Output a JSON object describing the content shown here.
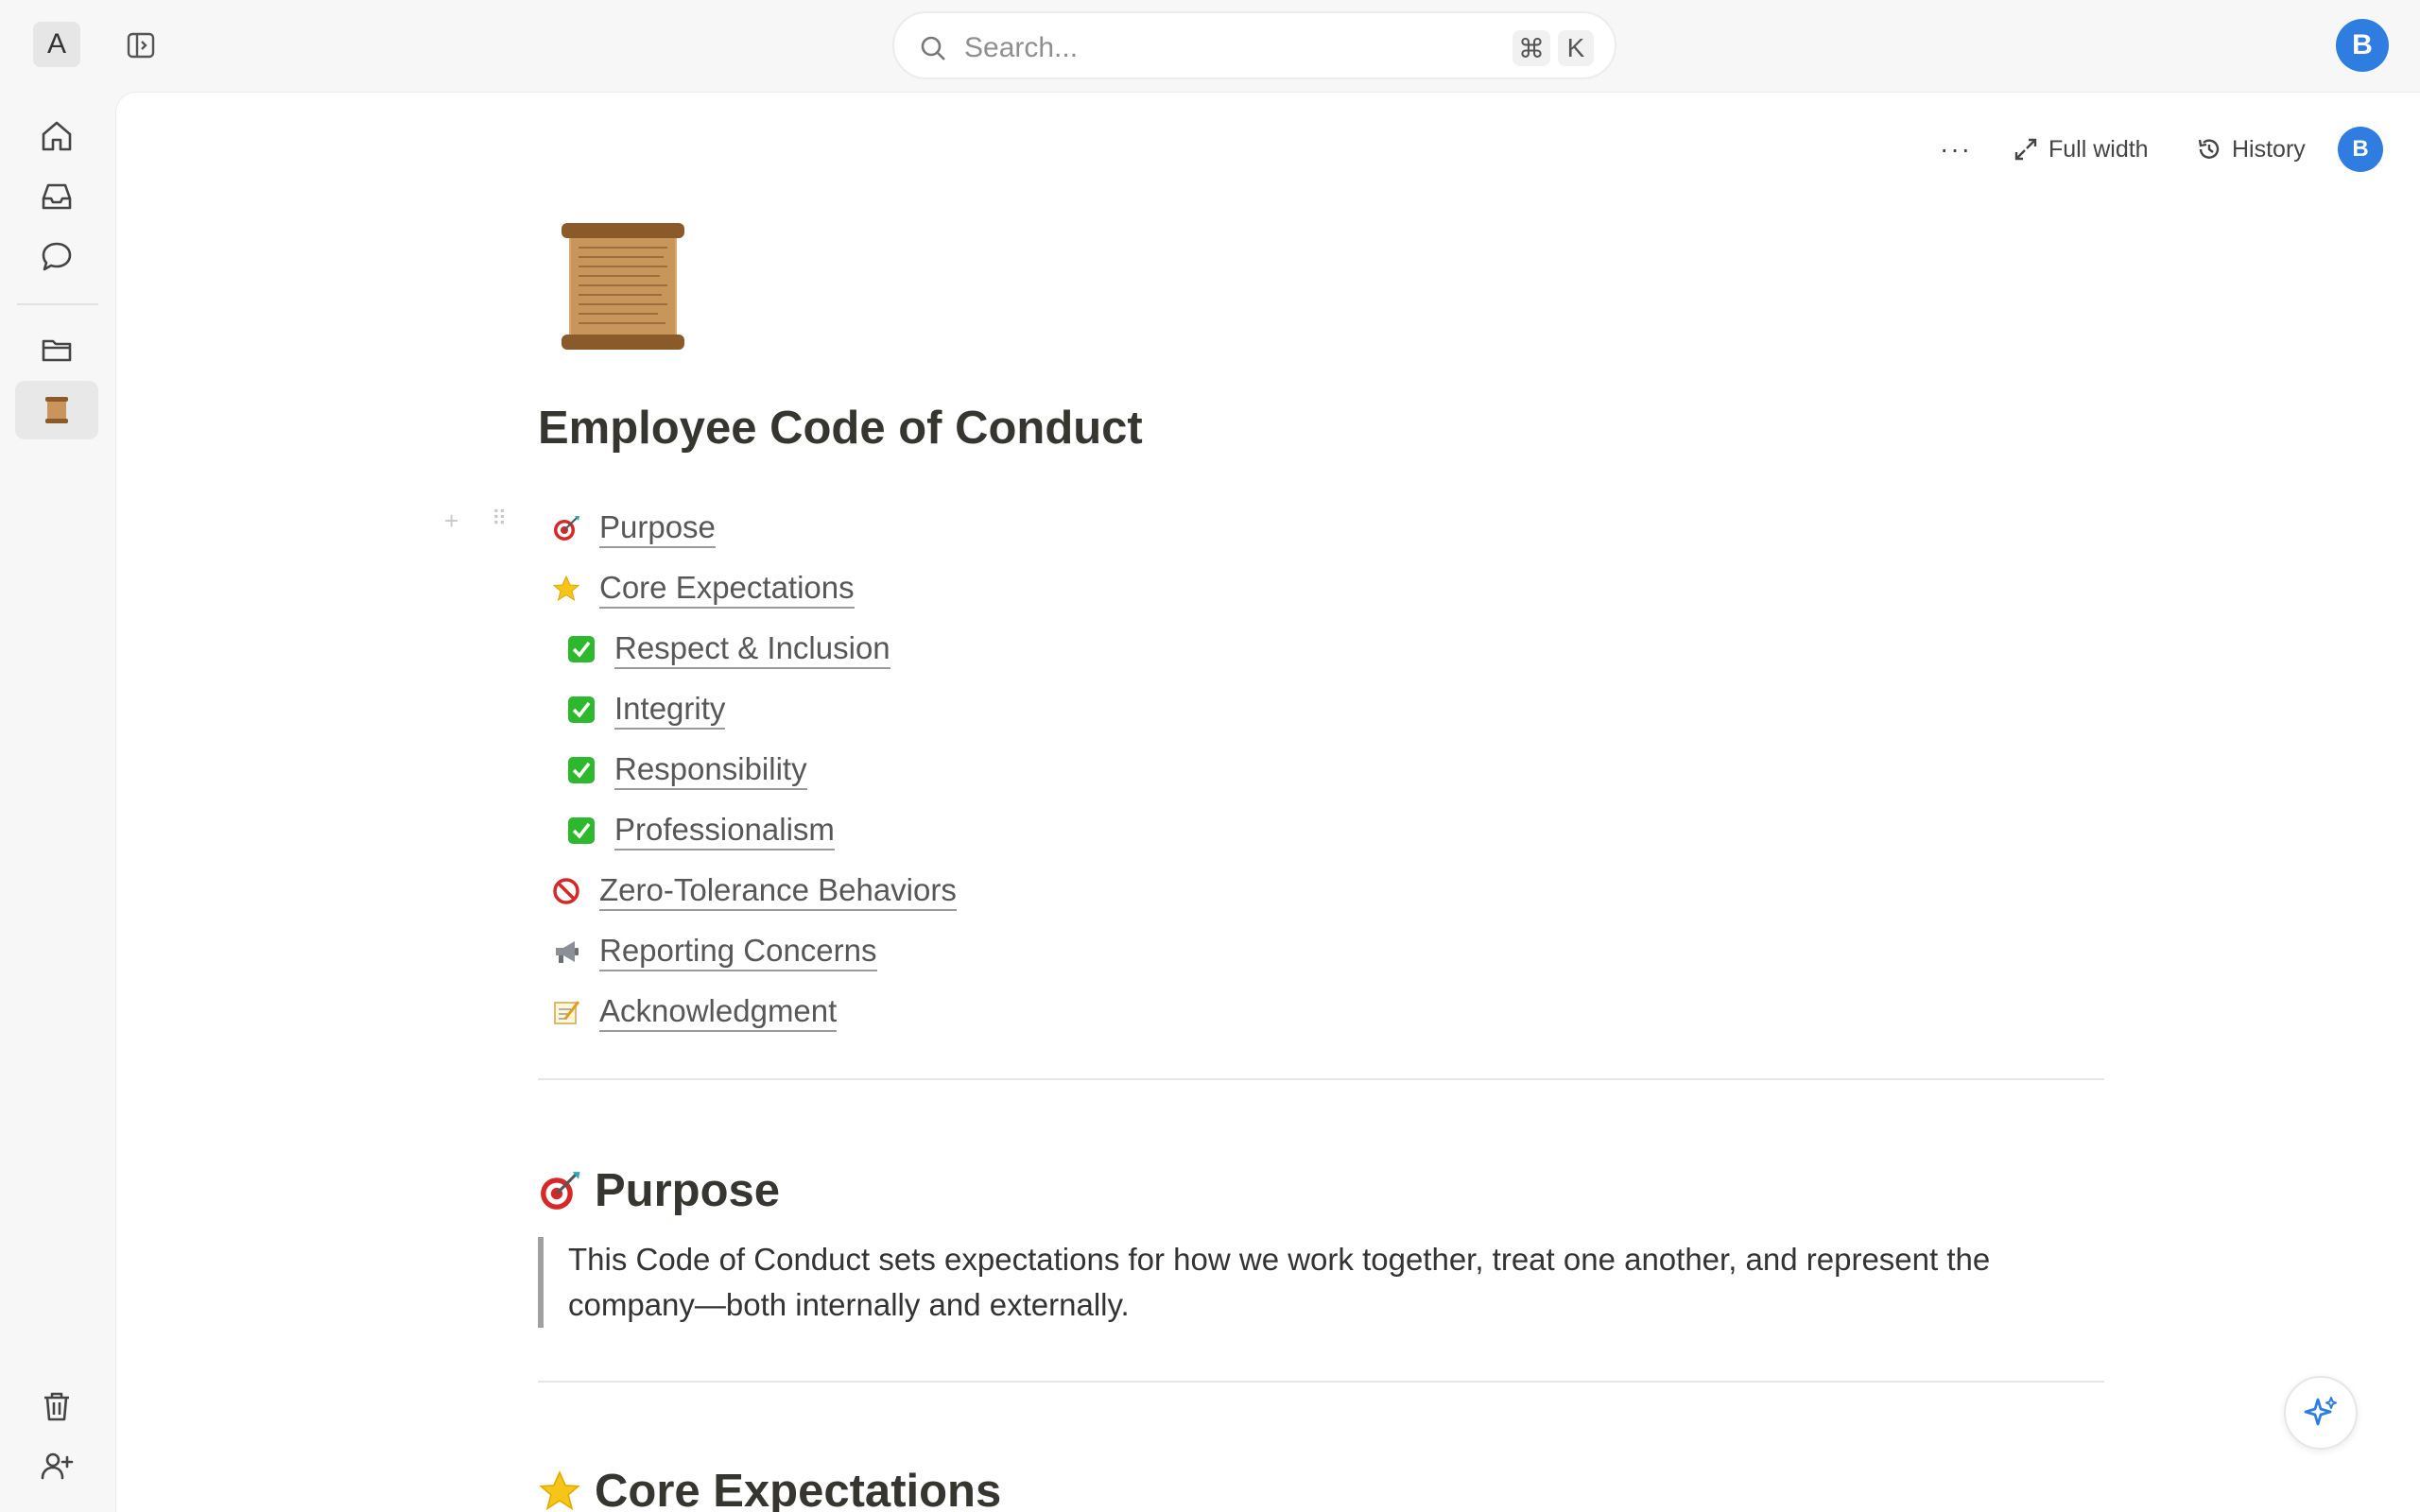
{
  "workspace": {
    "initial": "A"
  },
  "search": {
    "placeholder": "Search...",
    "shortcut_mod": "⌘",
    "shortcut_key": "K"
  },
  "user": {
    "initial": "B"
  },
  "toolbar": {
    "more_label": "···",
    "full_width_label": "Full width",
    "history_label": "History"
  },
  "document": {
    "title": "Employee Code of Conduct",
    "toc": [
      {
        "icon": "target-icon",
        "label": "Purpose"
      },
      {
        "icon": "star-icon",
        "label": "Core Expectations"
      },
      {
        "icon": "check-icon",
        "label": "Respect & Inclusion"
      },
      {
        "icon": "check-icon",
        "label": "Integrity"
      },
      {
        "icon": "check-icon",
        "label": "Responsibility"
      },
      {
        "icon": "check-icon",
        "label": "Professionalism"
      },
      {
        "icon": "prohibited-icon",
        "label": "Zero-Tolerance Behaviors"
      },
      {
        "icon": "megaphone-icon",
        "label": "Reporting Concerns"
      },
      {
        "icon": "memo-icon",
        "label": "Acknowledgment"
      }
    ],
    "sections": [
      {
        "icon": "target-icon",
        "heading": "Purpose",
        "body": "This Code of Conduct sets expectations for how we work together, treat one another, and represent the company—both internally and externally."
      },
      {
        "icon": "star-icon",
        "heading": "Core Expectations"
      }
    ]
  },
  "colors": {
    "accent": "#2f7de1",
    "background": "#f7f7f7",
    "text": "#37352f"
  }
}
